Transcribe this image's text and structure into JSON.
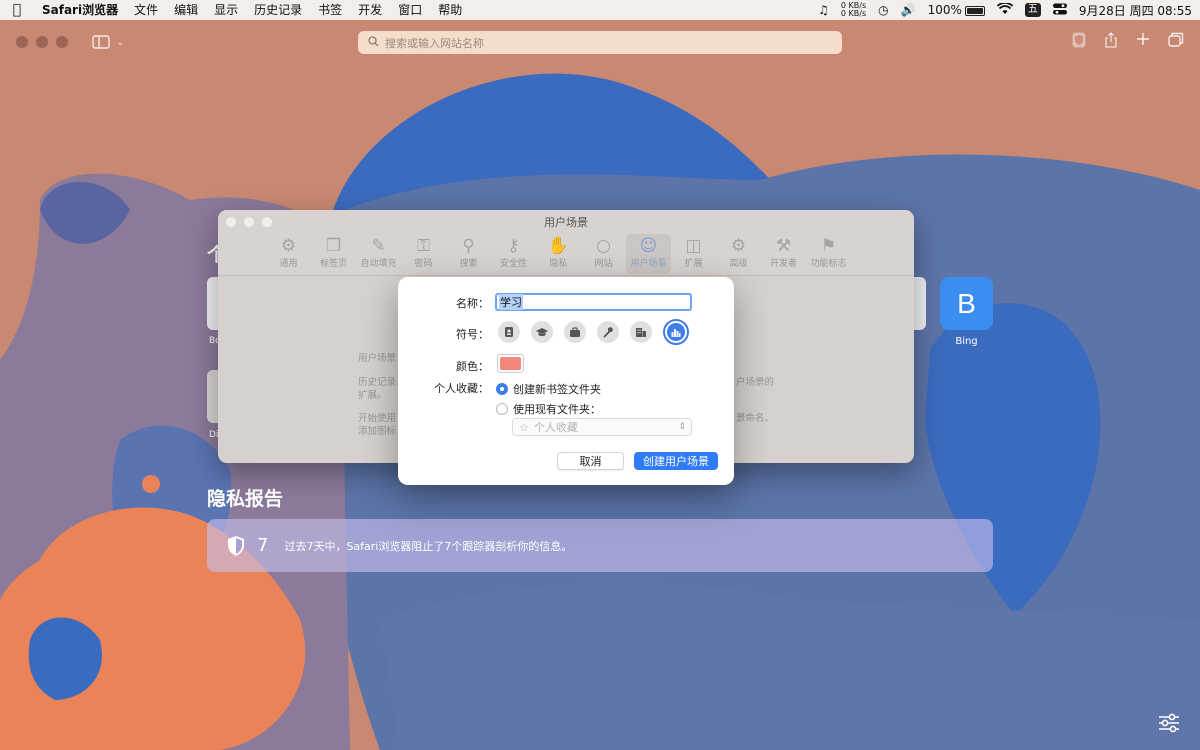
{
  "menubar": {
    "app": "Safari浏览器",
    "items": [
      "文件",
      "编辑",
      "显示",
      "历史记录",
      "书签",
      "开发",
      "窗口",
      "帮助"
    ],
    "net_up": "0 KB/s",
    "net_down": "0 KB/s",
    "battery": "100%",
    "input_method": "五",
    "datetime": "9月28日 周四  08:55"
  },
  "toolbar": {
    "address_placeholder": "搜索或输入网站名称"
  },
  "startpage": {
    "section_partial": "个",
    "fav_partial_label_1": "Bo",
    "fav_partial_label_2": "Di",
    "bing_letter": "B",
    "bing_label": "Bing",
    "privacy_title": "隐私报告",
    "privacy_count": "7",
    "privacy_message": "过去7天中，Safari浏览器阻止了7个跟踪器剖析你的信息。"
  },
  "prefs": {
    "title": "用户场景",
    "tabs": [
      {
        "label": "通用",
        "icon": "gear-icon"
      },
      {
        "label": "标签页",
        "icon": "tabs-icon"
      },
      {
        "label": "自动填充",
        "icon": "autofill-icon"
      },
      {
        "label": "密码",
        "icon": "key-icon"
      },
      {
        "label": "搜索",
        "icon": "search-icon"
      },
      {
        "label": "安全性",
        "icon": "lock-icon"
      },
      {
        "label": "隐私",
        "icon": "hand-icon"
      },
      {
        "label": "网站",
        "icon": "globe-icon"
      },
      {
        "label": "用户场景",
        "icon": "person-icon"
      },
      {
        "label": "扩展",
        "icon": "puzzle-icon"
      },
      {
        "label": "高级",
        "icon": "gears-icon"
      },
      {
        "label": "开发者",
        "icon": "tools-icon"
      },
      {
        "label": "功能标志",
        "icon": "flags-icon"
      }
    ],
    "body_left_1": "用户场景",
    "body_left_2": "历史记录，",
    "body_left_3": "扩展。",
    "body_left_4": "开始使用",
    "body_left_5": "添加图标",
    "body_right_1": "户场景的",
    "body_right_2": "景命名、"
  },
  "dialog": {
    "name_label": "名称：",
    "name_value": "学习",
    "symbol_label": "符号：",
    "symbols": [
      "id-badge-icon",
      "graduation-cap-icon",
      "briefcase-icon",
      "hammer-icon",
      "building-icon",
      "chart-icon"
    ],
    "selected_symbol": "chart-icon",
    "color_label": "颜色：",
    "color_value": "#f4867c",
    "favorites_label": "个人收藏：",
    "option_new_folder": "创建新书签文件夹",
    "option_existing_folder": "使用现有文件夹：",
    "folder_select_value": "个人收藏",
    "cancel_label": "取消",
    "create_label": "创建用户场景"
  }
}
